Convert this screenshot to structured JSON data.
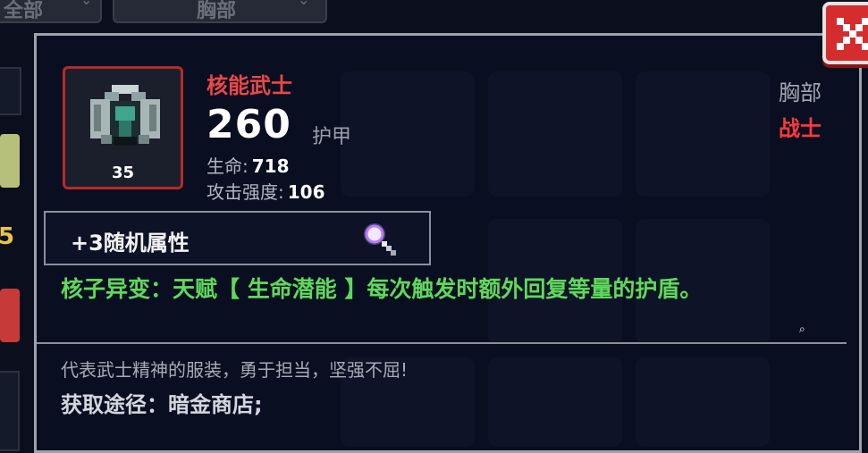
{
  "background": {
    "tabs": [
      {
        "label": "全部"
      },
      {
        "label": "胸部"
      }
    ],
    "side_number": "5"
  },
  "popup": {
    "item": {
      "name": "核能武士",
      "count": "35",
      "armor_value": "260",
      "armor_label": "护甲",
      "stats": [
        {
          "key": "生命:",
          "value": "718"
        },
        {
          "key": "攻击强度:",
          "value": "106"
        }
      ],
      "slot_type": "胸部",
      "class_type": "战士",
      "rarity_color": "#b52a2a"
    },
    "random_attr_label": "+3随机属性",
    "effect_text": "核子异变：天赋【 生命潜能 】每次触发时额外回复等量的护盾。",
    "flavor_text": "代表武士精神的服装，勇于担当，坚强不屈!",
    "source_text": "获取途径：暗金商店;",
    "icons": [
      "armor-item-icon",
      "magnifier-icon",
      "close-icon",
      "search-icon"
    ]
  }
}
